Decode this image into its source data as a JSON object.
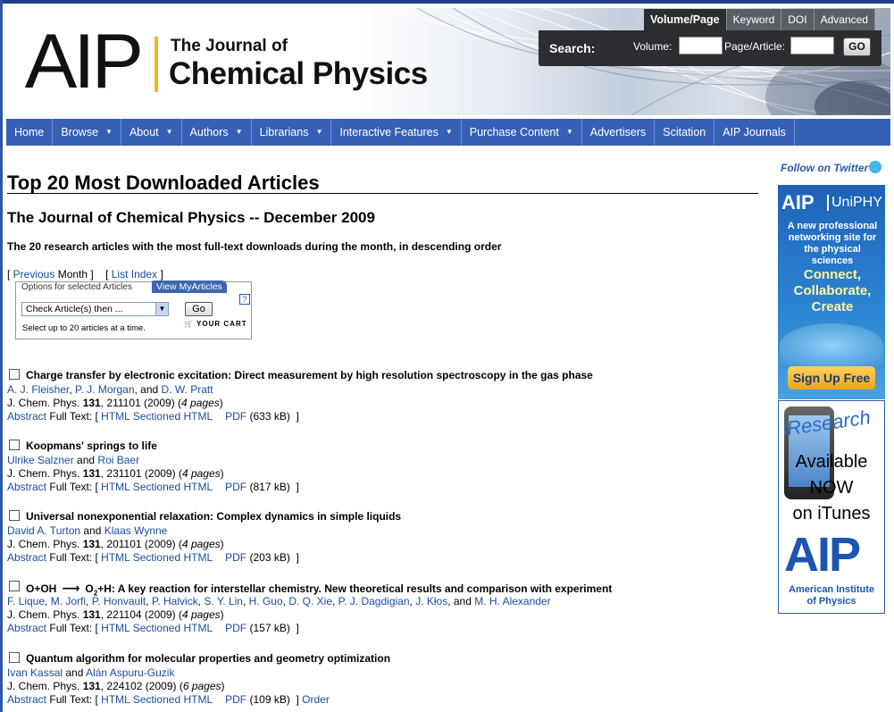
{
  "header": {
    "logo_mark": "AIP",
    "logo_line1": "The Journal of",
    "logo_line2": "Chemical Physics"
  },
  "search": {
    "tabs": [
      "Volume/Page",
      "Keyword",
      "DOI",
      "Advanced"
    ],
    "label": "Search:",
    "volume_label": "Volume:",
    "page_label": "Page/Article:",
    "volume_value": "",
    "page_value": "",
    "go_label": "GO"
  },
  "nav": {
    "items": [
      {
        "label": "Home",
        "dropdown": false
      },
      {
        "label": "Browse",
        "dropdown": true
      },
      {
        "label": "About",
        "dropdown": true
      },
      {
        "label": "Authors",
        "dropdown": true
      },
      {
        "label": "Librarians",
        "dropdown": true
      },
      {
        "label": "Interactive Features",
        "dropdown": true
      },
      {
        "label": "Purchase Content",
        "dropdown": true
      },
      {
        "label": "Advertisers",
        "dropdown": false
      },
      {
        "label": "Scitation",
        "dropdown": false
      },
      {
        "label": "AIP Journals",
        "dropdown": false
      }
    ]
  },
  "main": {
    "title": "Top 20 Most Downloaded Articles",
    "subtitle": "The Journal of Chemical Physics -- December 2009",
    "description": "The 20 research articles with the most full-text downloads during the month, in descending order",
    "prev_link": "Previous",
    "prev_suffix": "Month",
    "list_index": "List Index"
  },
  "options": {
    "tab_label": "Options for selected Articles",
    "tab2_label": "View MyArticles",
    "select_value": "Check Article(s) then ...",
    "go_label": "Go",
    "help": "?",
    "note": "Select up to 20 articles at a time.",
    "cart_label": "YOUR CART"
  },
  "labels": {
    "abstract": "Abstract",
    "full_text": "Full Text:",
    "html": "HTML",
    "sectioned_html": "Sectioned HTML",
    "pdf": "PDF",
    "journal": "J. Chem. Phys.",
    "order": "Order"
  },
  "articles": [
    {
      "title": "Charge transfer by electronic excitation: Direct measurement by high resolution spectroscopy in the gas phase",
      "authors": [
        "A. J. Fleisher",
        "P. J. Morgan",
        "D. W. Pratt"
      ],
      "volume": "131",
      "article": "211101",
      "year": "(2009)",
      "pages": "4 pages",
      "size": "(633 kB)"
    },
    {
      "title": "Koopmans' springs to life",
      "authors": [
        "Ulrike Salzner",
        "Roi Baer"
      ],
      "volume": "131",
      "article": "231101",
      "year": "(2009)",
      "pages": "4 pages",
      "size": "(817 kB)"
    },
    {
      "title": "Universal nonexponential relaxation: Complex dynamics in simple liquids",
      "authors": [
        "David A. Turton",
        "Klaas Wynne"
      ],
      "volume": "131",
      "article": "201101",
      "year": "(2009)",
      "pages": "4 pages",
      "size": "(203 kB)"
    },
    {
      "title_pre": "O+OH",
      "title_post": "O",
      "title_rest": "+H: A key reaction for interstellar chemistry. New theoretical results and comparison with experiment",
      "authors": [
        "F. Lique",
        "M. Jorfi",
        "P. Honvault",
        "P. Halvick",
        "S. Y. Lin",
        "H. Guo",
        "D. Q. Xie",
        "P. J. Dagdigian",
        "J. Kłos",
        "M. H. Alexander"
      ],
      "volume": "131",
      "article": "221104",
      "year": "(2009)",
      "pages": "4 pages",
      "size": "(157 kB)"
    },
    {
      "title": "Quantum algorithm for molecular properties and geometry optimization",
      "authors": [
        "Ivan Kassal",
        "Alán Aspuru-Guzik"
      ],
      "volume": "131",
      "article": "224102",
      "year": "(2009)",
      "pages": "6 pages",
      "size": "(109 kB)",
      "order": true
    }
  ],
  "sidebar": {
    "twitter": "Follow on Twitter",
    "ad1": {
      "logo": "AIP",
      "brand": "UniPHY",
      "tagline": "A new professional networking site for the physical sciences",
      "slogan": [
        "Connect,",
        "Collaborate,",
        "Create"
      ],
      "button": "Sign Up Free"
    },
    "ad2": {
      "brand": "iResearch",
      "lines": [
        "Available",
        "NOW",
        "on iTunes"
      ],
      "logo": "AIP",
      "org": [
        "American Institute",
        "of Physics"
      ]
    }
  }
}
